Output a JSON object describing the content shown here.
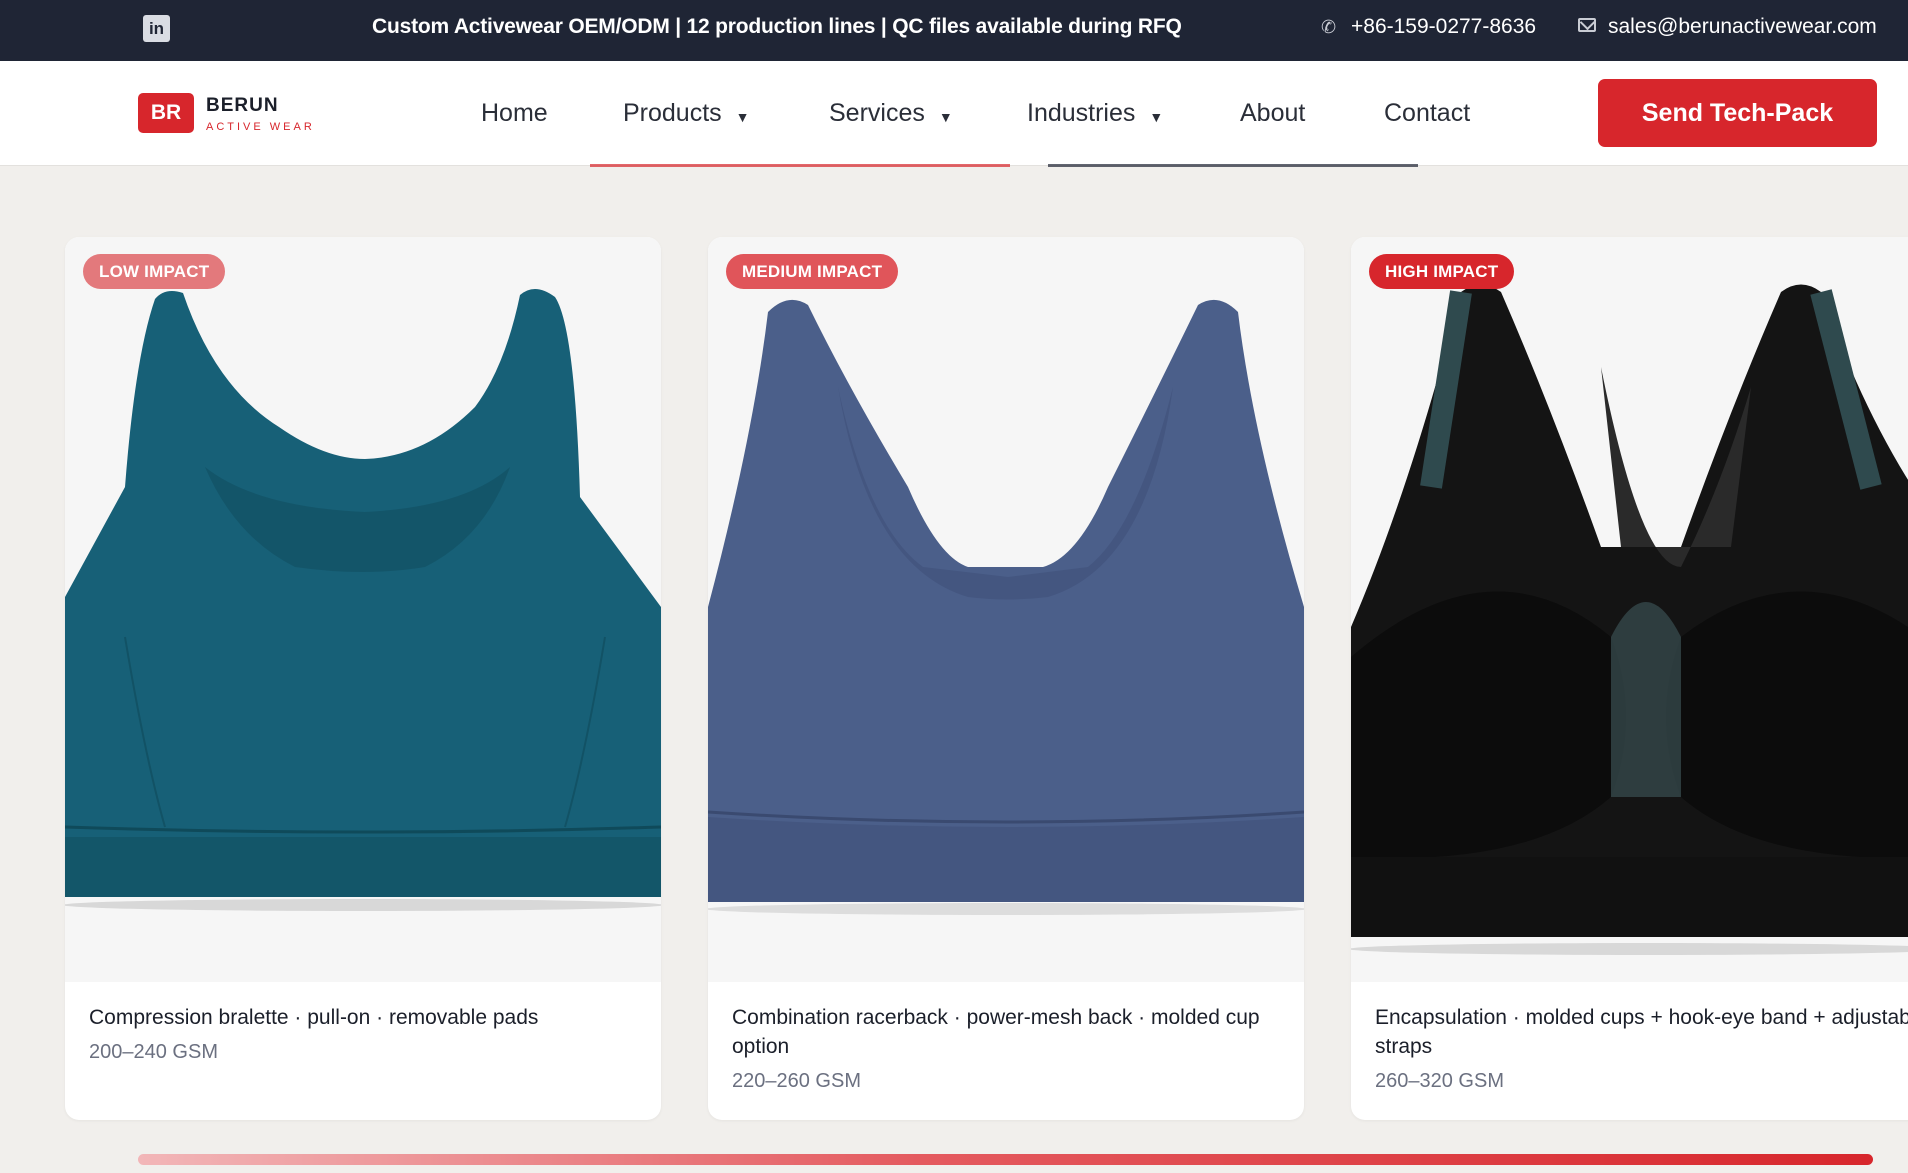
{
  "topbar": {
    "linkedin_icon": "linkedin-icon",
    "tagline": "Custom Activewear OEM/ODM | 12 production lines | QC files available during RFQ",
    "phone_icon": "phone-icon",
    "phone": "+86-159-0277-8636",
    "email_icon": "mail-icon",
    "email": "sales@berunactivewear.com"
  },
  "header": {
    "logo_mark": "BR",
    "brand": "BERUN",
    "brand_sub": "ACTIVE WEAR",
    "nav": [
      {
        "label": "Home",
        "dropdown": false
      },
      {
        "label": "Products",
        "dropdown": true
      },
      {
        "label": "Services",
        "dropdown": true
      },
      {
        "label": "Industries",
        "dropdown": true
      },
      {
        "label": "About",
        "dropdown": false
      },
      {
        "label": "Contact",
        "dropdown": false
      }
    ],
    "caret": "▼",
    "cta": "Send Tech-Pack"
  },
  "colors": {
    "brand_red": "#d7262c",
    "dark": "#1f2535",
    "badge_low": "#e3797c",
    "badge_medium": "#e0555a",
    "badge_high": "#d7262c"
  },
  "products": [
    {
      "badge": "LOW IMPACT",
      "description": "Compression bralette · pull-on · removable pads",
      "gsm": "200–240 GSM",
      "garment_color": "#176077"
    },
    {
      "badge": "MEDIUM IMPACT",
      "description": "Combination racerback · power-mesh back · molded cup option",
      "gsm": "220–260 GSM",
      "garment_color": "#4b5f8a"
    },
    {
      "badge": "HIGH IMPACT",
      "description": "Encapsulation · molded cups + hook-eye band + adjustable straps",
      "gsm": "260–320 GSM",
      "garment_color": "#141414"
    }
  ]
}
